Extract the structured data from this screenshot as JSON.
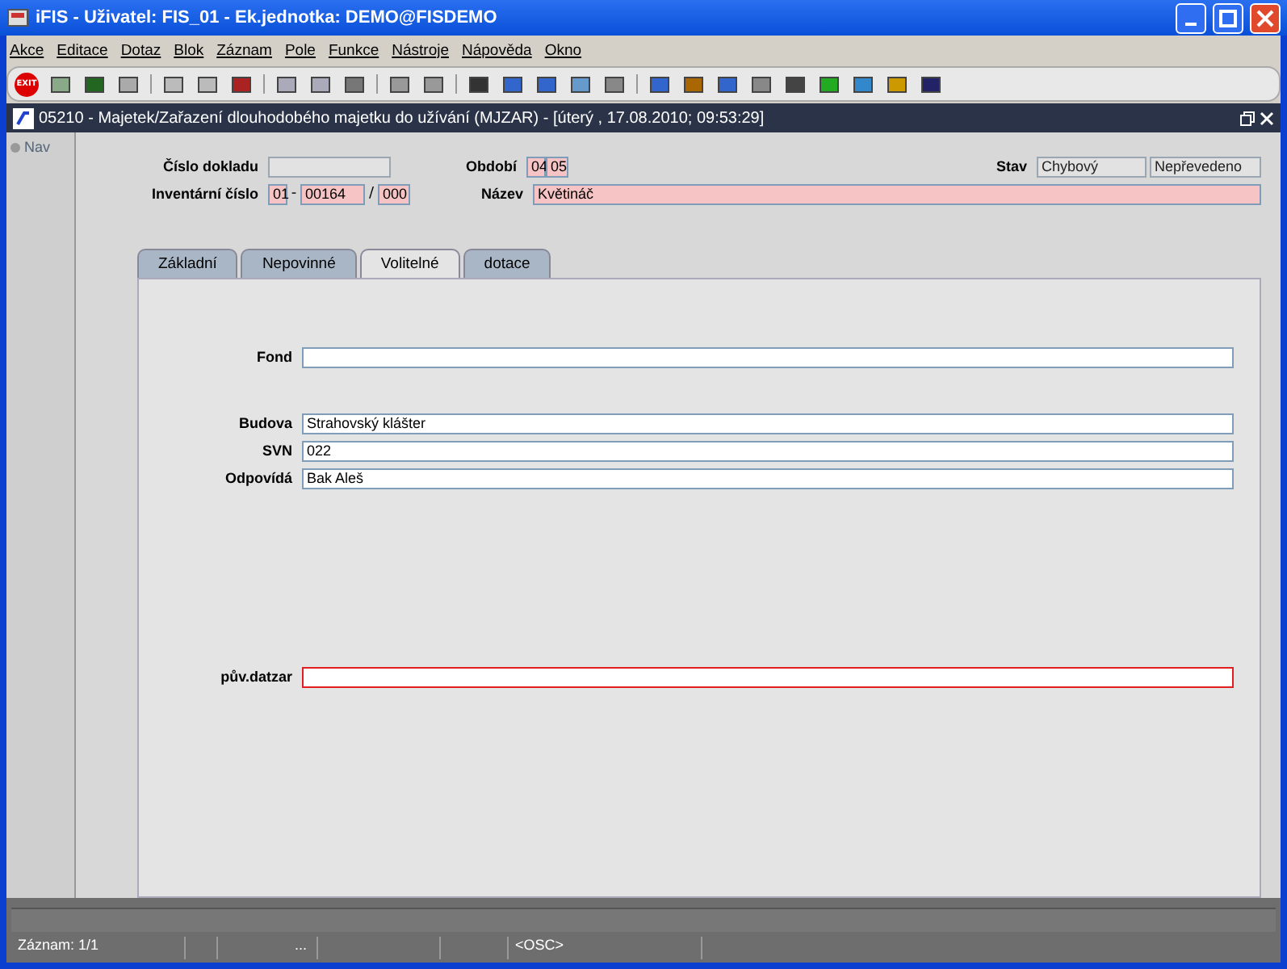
{
  "window": {
    "title": "iFIS - Uživatel: FIS_01 - Ek.jednotka: DEMO@FISDEMO"
  },
  "menu": [
    "Akce",
    "Editace",
    "Dotaz",
    "Blok",
    "Záznam",
    "Pole",
    "Funkce",
    "Nástroje",
    "Nápověda",
    "Okno"
  ],
  "toolbar": {
    "exit_label": "EXIT"
  },
  "form_window": {
    "title": "05210 - Majetek/Zařazení dlouhodobého majetku do užívání (MJZAR) - [úterý  , 17.08.2010; 09:53:29]"
  },
  "nav": {
    "label": "Nav",
    "selected": false
  },
  "header": {
    "cislo_dokladu": {
      "label": "Číslo dokladu",
      "required": false,
      "readonly": true,
      "error": false
    },
    "inventarni_cislo": {
      "label": "Inventární číslo",
      "parts": [
        {
          "value": "01",
          "required": true,
          "readonly": false,
          "error": false
        },
        {
          "value": "00164",
          "required": true,
          "readonly": false,
          "error": false
        },
        {
          "value": "000",
          "required": true,
          "readonly": false,
          "error": false
        }
      ],
      "separators": [
        "-",
        "/"
      ]
    },
    "obdobi": {
      "label": "Období",
      "parts": [
        {
          "value": "04",
          "required": true,
          "readonly": false,
          "error": false
        },
        {
          "value": "05",
          "required": true,
          "readonly": false,
          "error": false
        }
      ]
    },
    "nazev": {
      "label": "Název",
      "value": "Květináč",
      "required": true,
      "readonly": false,
      "error": false
    },
    "stav": {
      "label": "Stav",
      "parts": [
        {
          "value": "Chybový",
          "required": false,
          "readonly": true,
          "error": false
        },
        {
          "value": "Nepřevedeno",
          "required": false,
          "readonly": true,
          "error": false
        }
      ]
    }
  },
  "tabs": [
    {
      "label": "Základní",
      "selected": false
    },
    {
      "label": "Nepovinné",
      "selected": false
    },
    {
      "label": "Volitelné",
      "selected": true
    },
    {
      "label": "dotace",
      "selected": false
    }
  ],
  "field_groups": [
    [
      {
        "label": "Fond",
        "required": false,
        "readonly": false,
        "error": false
      }
    ],
    [
      {
        "label": "Budova",
        "value": "Strahovský klášter",
        "required": false,
        "readonly": false,
        "error": false
      },
      {
        "label": "SVN",
        "value": "022",
        "required": false,
        "readonly": false,
        "error": false
      },
      {
        "label": "Odpovídá",
        "value": "Bak Aleš",
        "required": false,
        "readonly": false,
        "error": false
      }
    ],
    [
      {
        "label": "pův.datzar",
        "required": false,
        "readonly": false,
        "error": true
      }
    ]
  ],
  "status_bar": {
    "record": "Záznam: 1/1",
    "ellipsis": "...",
    "mode": "<OSC>"
  }
}
